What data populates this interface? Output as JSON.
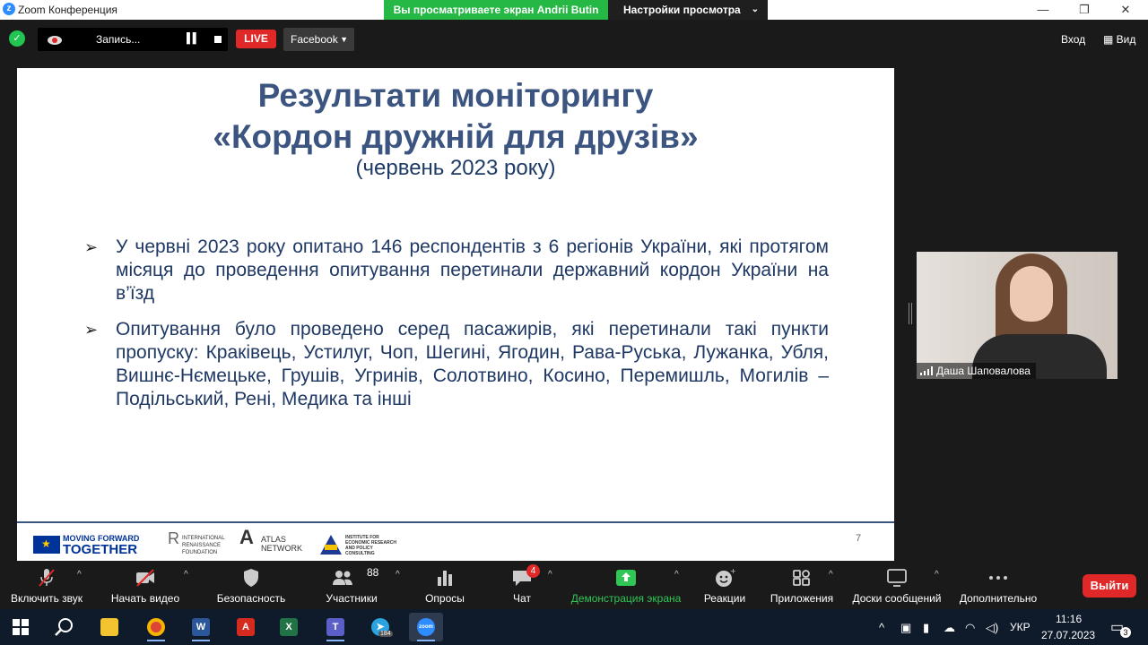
{
  "window": {
    "title": "Zoom Конференция",
    "share_banner": "Вы просматриваете экран Andrii Butin",
    "view_options": "Настройки просмотра"
  },
  "topbar": {
    "recording_label": "Запись...",
    "live_label": "LIVE",
    "stream_target": "Facebook",
    "exit_label": "Вход",
    "view_label": "Вид"
  },
  "slide": {
    "title_line1": "Результати моніторингу",
    "title_line2": "«Кордон дружній для друзів»",
    "subtitle": "(червень 2023 року)",
    "bullets": [
      "У червні 2023 року опитано 146 респондентів з 6 регіонів України, які протягом місяця до проведення опитування перетинали державний кордон України на в’їзд",
      "Опитування було проведено серед пасажирів, які перетинали такі пункти пропуску: Краківець, Устилуг, Чоп, Шегині, Ягодин, Рава-Руська, Лужанка, Убля, Вишнє-Нємецьке, Грушів, Угринів, Солотвино, Косино, Перемишль, Могилів – Подільський, Рені, Медика та інші"
    ],
    "page_number": "7",
    "logos": {
      "mft_small": "MOVING FORWARD",
      "mft_big": "TOGETHER",
      "irf": "INTERNATIONAL RENAISSANCE FOUNDATION",
      "atlas": "ATLAS NETWORK",
      "ier": "INSTITUTE FOR ECONOMIC RESEARCH AND POLICY CONSULTING"
    }
  },
  "participant": {
    "name": "Даша Шаповалова"
  },
  "toolbar": {
    "unmute": "Включить звук",
    "start_video": "Начать видео",
    "security": "Безопасность",
    "participants": "Участники",
    "participants_count": "88",
    "polls": "Опросы",
    "chat": "Чат",
    "chat_badge": "4",
    "share_screen": "Демонстрация экрана",
    "reactions": "Реакции",
    "apps": "Приложения",
    "whiteboards": "Доски сообщений",
    "more": "Дополнительно",
    "leave": "Выйти"
  },
  "taskbar": {
    "telegram_badge": "184",
    "zoom_label": "zoom",
    "language": "УКР",
    "time": "11:16",
    "date": "27.07.2023",
    "notifications": "3"
  },
  "colors": {
    "share_green": "#26b845",
    "live_red": "#e02828",
    "slide_title": "#3b5480",
    "slide_text": "#1f3864"
  }
}
